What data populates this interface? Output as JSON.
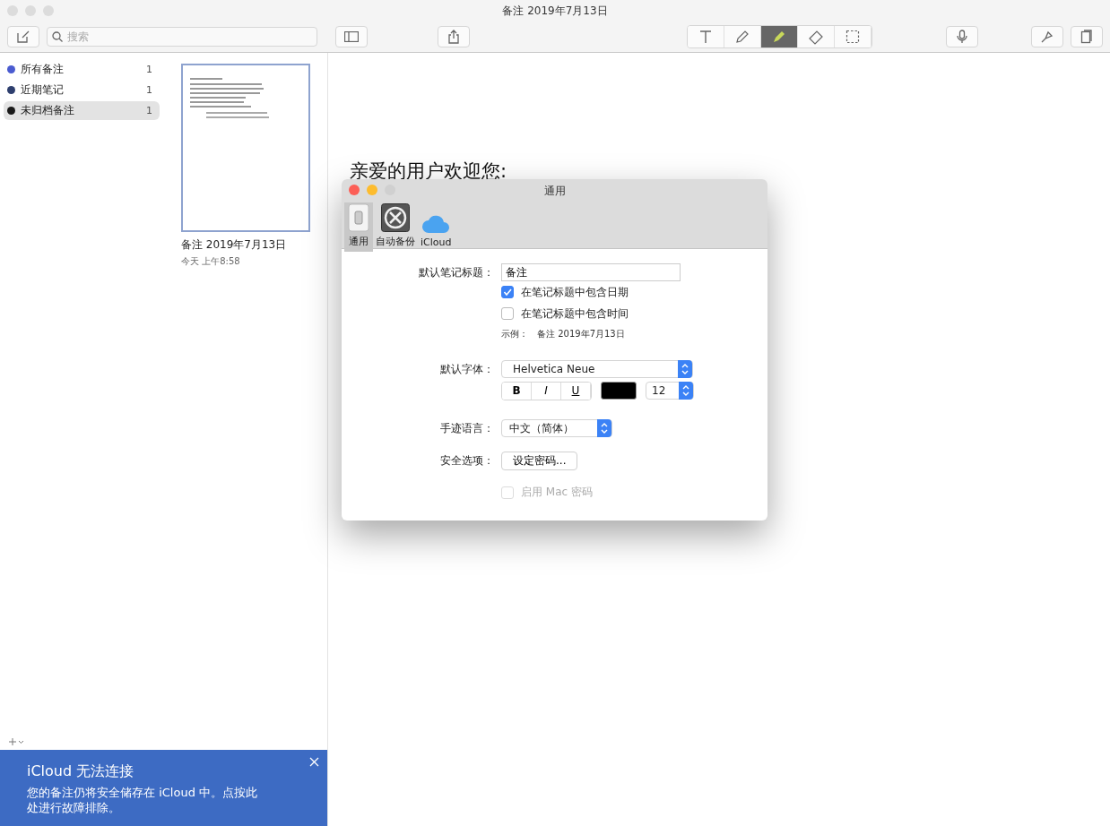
{
  "window": {
    "title": "备注 2019年7月13日"
  },
  "toolbar": {
    "search_placeholder": "搜索",
    "tools": [
      {
        "kind": "text",
        "selected": false
      },
      {
        "kind": "pen",
        "selected": false
      },
      {
        "kind": "highlighter",
        "selected": true
      },
      {
        "kind": "eraser",
        "selected": false
      },
      {
        "kind": "select",
        "selected": false
      }
    ]
  },
  "folders": [
    {
      "name": "所有备注",
      "count": "1",
      "color": "#4a5bd0",
      "selected": false
    },
    {
      "name": "近期笔记",
      "count": "1",
      "color": "#2e3f6e",
      "selected": false
    },
    {
      "name": "未归档备注",
      "count": "1",
      "color": "#1a1a1a",
      "selected": true
    }
  ],
  "notes": [
    {
      "title": "备注 2019年7月13日",
      "date": "今天 上午8:58",
      "selected": true
    }
  ],
  "editor": {
    "heading": "亲爱的用户欢迎您:"
  },
  "banner": {
    "title": "iCloud 无法连接",
    "message": "您的备注仍将安全储存在 iCloud 中。点按此处进行故障排除。"
  },
  "preferences": {
    "title": "通用",
    "tabs": [
      {
        "label": "通用",
        "kind": "general",
        "selected": true
      },
      {
        "label": "自动备份",
        "kind": "backup",
        "selected": false
      },
      {
        "label": "iCloud",
        "kind": "icloud",
        "selected": false
      }
    ],
    "default_title": {
      "label": "默认笔记标题：",
      "value": "备注"
    },
    "options": [
      {
        "label": "在笔记标题中包含日期",
        "checked": true
      },
      {
        "label": "在笔记标题中包含时间",
        "checked": false
      }
    ],
    "example": {
      "label": "示例：",
      "value": "备注 2019年7月13日"
    },
    "font": {
      "label": "默认字体：",
      "value": "Helvetica Neue",
      "styles": [
        "B",
        "I",
        "U"
      ],
      "color": "#000000",
      "size": "12"
    },
    "handwriting": {
      "label": "手迹语言：",
      "value": "中文（简体）"
    },
    "security": {
      "label": "安全选项：",
      "button": "设定密码...",
      "mac_password": {
        "label": "启用 Mac 密码",
        "checked": false,
        "disabled": true
      }
    }
  }
}
